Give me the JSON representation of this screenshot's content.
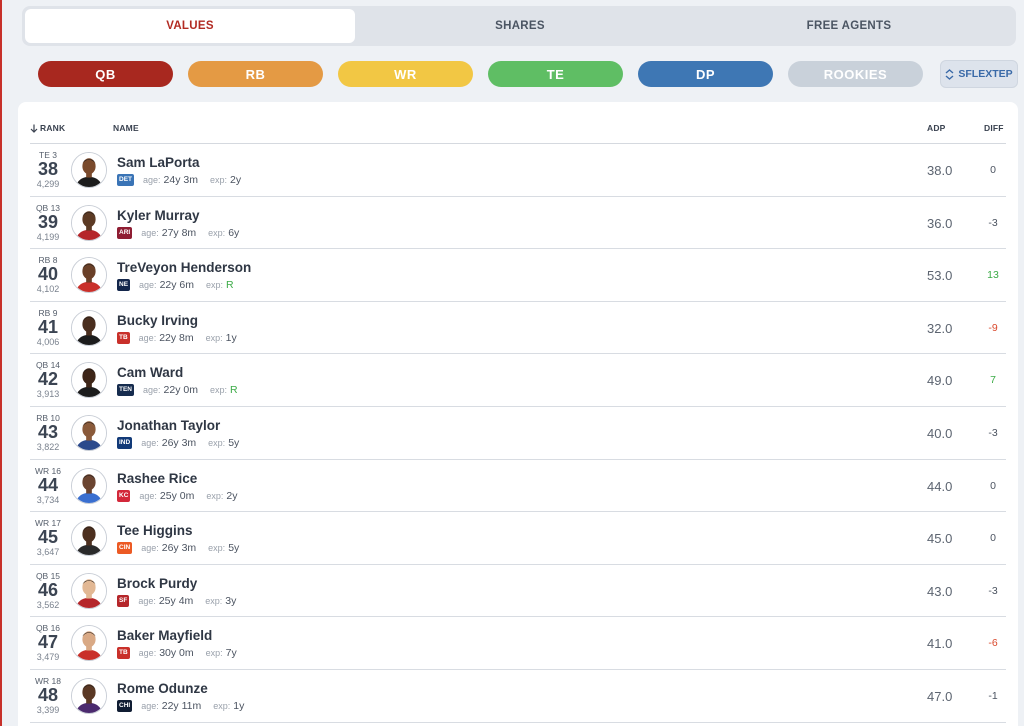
{
  "tabs": [
    {
      "label": "VALUES",
      "active": true
    },
    {
      "label": "SHARES",
      "active": false
    },
    {
      "label": "FREE AGENTS",
      "active": false
    }
  ],
  "positions": [
    {
      "label": "QB",
      "color": "#a8281f"
    },
    {
      "label": "RB",
      "color": "#e49a44"
    },
    {
      "label": "WR",
      "color": "#f2c744"
    },
    {
      "label": "TE",
      "color": "#5fbe64"
    },
    {
      "label": "DP",
      "color": "#3e77b4"
    },
    {
      "label": "ROOKIES",
      "color": "#c9d1da"
    }
  ],
  "format_button": {
    "label": "SFLEXTEP",
    "icon": "sort-icon"
  },
  "table": {
    "headers": {
      "rank": "RANK",
      "name": "NAME",
      "adp": "ADP",
      "diff": "DIFF"
    },
    "age_label": "age:",
    "exp_label": "exp:",
    "rows": [
      {
        "pos_rank": "TE 3",
        "rank": "38",
        "value": "4,299",
        "name": "Sam LaPorta",
        "team": "DET",
        "team_color": "#3a74b6",
        "age": "24y 3m",
        "exp": "2y",
        "adp": "38.0",
        "diff": "0",
        "diff_type": "zero"
      },
      {
        "pos_rank": "QB 13",
        "rank": "39",
        "value": "4,199",
        "name": "Kyler Murray",
        "team": "ARI",
        "team_color": "#8f1d33",
        "age": "27y 8m",
        "exp": "6y",
        "adp": "36.0",
        "diff": "-3",
        "diff_type": "zero"
      },
      {
        "pos_rank": "RB 8",
        "rank": "40",
        "value": "4,102",
        "name": "TreVeyon Henderson",
        "team": "NE",
        "team_color": "#13264b",
        "age": "22y 6m",
        "exp": "R",
        "adp": "53.0",
        "diff": "13",
        "diff_type": "pos"
      },
      {
        "pos_rank": "RB 9",
        "rank": "41",
        "value": "4,006",
        "name": "Bucky Irving",
        "team": "TB",
        "team_color": "#c9302a",
        "age": "22y 8m",
        "exp": "1y",
        "adp": "32.0",
        "diff": "-9",
        "diff_type": "neg"
      },
      {
        "pos_rank": "QB 14",
        "rank": "42",
        "value": "3,913",
        "name": "Cam Ward",
        "team": "TEN",
        "team_color": "#162c4e",
        "age": "22y 0m",
        "exp": "R",
        "adp": "49.0",
        "diff": "7",
        "diff_type": "pos"
      },
      {
        "pos_rank": "RB 10",
        "rank": "43",
        "value": "3,822",
        "name": "Jonathan Taylor",
        "team": "IND",
        "team_color": "#123a78",
        "age": "26y 3m",
        "exp": "5y",
        "adp": "40.0",
        "diff": "-3",
        "diff_type": "zero"
      },
      {
        "pos_rank": "WR 16",
        "rank": "44",
        "value": "3,734",
        "name": "Rashee Rice",
        "team": "KC",
        "team_color": "#d3283a",
        "age": "25y 0m",
        "exp": "2y",
        "adp": "44.0",
        "diff": "0",
        "diff_type": "zero"
      },
      {
        "pos_rank": "WR 17",
        "rank": "45",
        "value": "3,647",
        "name": "Tee Higgins",
        "team": "CIN",
        "team_color": "#ec5a24",
        "age": "26y 3m",
        "exp": "5y",
        "adp": "45.0",
        "diff": "0",
        "diff_type": "zero"
      },
      {
        "pos_rank": "QB 15",
        "rank": "46",
        "value": "3,562",
        "name": "Brock Purdy",
        "team": "SF",
        "team_color": "#b5262a",
        "age": "25y 4m",
        "exp": "3y",
        "adp": "43.0",
        "diff": "-3",
        "diff_type": "zero"
      },
      {
        "pos_rank": "QB 16",
        "rank": "47",
        "value": "3,479",
        "name": "Baker Mayfield",
        "team": "TB",
        "team_color": "#c9302a",
        "age": "30y 0m",
        "exp": "7y",
        "adp": "41.0",
        "diff": "-6",
        "diff_type": "neg"
      },
      {
        "pos_rank": "WR 18",
        "rank": "48",
        "value": "3,399",
        "name": "Rome Odunze",
        "team": "CHI",
        "team_color": "#101d33",
        "age": "22y 11m",
        "exp": "1y",
        "adp": "47.0",
        "diff": "-1",
        "diff_type": "zero"
      }
    ]
  }
}
